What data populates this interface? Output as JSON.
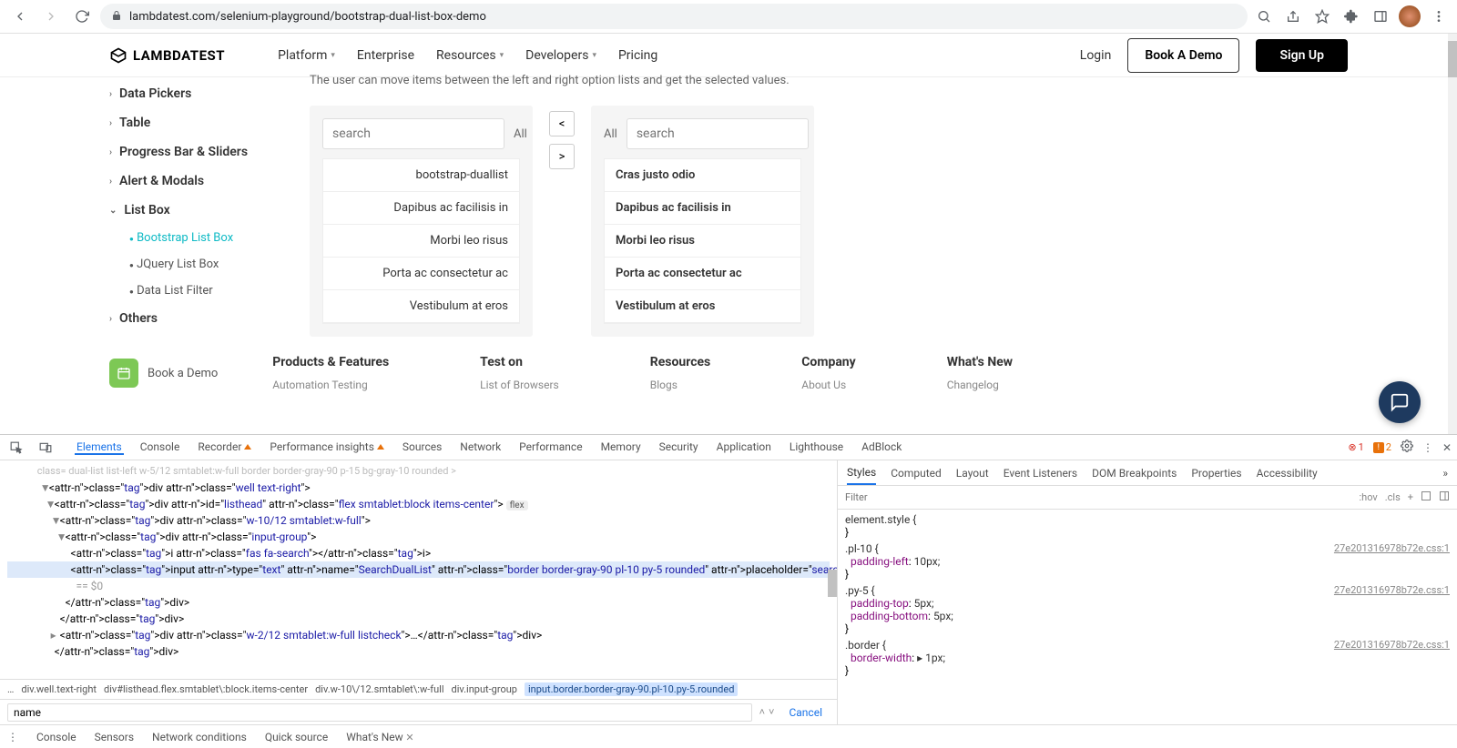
{
  "browser": {
    "url_display": "lambdatest.com/selenium-playground/bootstrap-dual-list-box-demo"
  },
  "topnav": {
    "brand": "LAMBDATEST",
    "links": [
      "Platform",
      "Enterprise",
      "Resources",
      "Developers",
      "Pricing"
    ],
    "login": "Login",
    "book_demo": "Book A Demo",
    "signup": "Sign Up"
  },
  "sidebar": {
    "items": [
      {
        "label": "Data Pickers",
        "expanded": false
      },
      {
        "label": "Table",
        "expanded": false
      },
      {
        "label": "Progress Bar & Sliders",
        "expanded": false
      },
      {
        "label": "Alert & Modals",
        "expanded": false
      },
      {
        "label": "List Box",
        "expanded": true,
        "sub": [
          {
            "label": "Bootstrap List Box",
            "active": true
          },
          {
            "label": "JQuery List Box",
            "active": false
          },
          {
            "label": "Data List Filter",
            "active": false
          }
        ]
      },
      {
        "label": "Others",
        "expanded": false
      }
    ]
  },
  "playground": {
    "description": "The user can move items between the left and right option lists and get the selected values.",
    "search_placeholder": "search",
    "all_label": "All",
    "move_left": "<",
    "move_right": ">",
    "left_list": [
      "bootstrap-duallist",
      "Dapibus ac facilisis in",
      "Morbi leo risus",
      "Porta ac consectetur ac",
      "Vestibulum at eros"
    ],
    "right_list": [
      "Cras justo odio",
      "Dapibus ac facilisis in",
      "Morbi leo risus",
      "Porta ac consectetur ac",
      "Vestibulum at eros"
    ]
  },
  "footer": {
    "book_demo": "Book a Demo",
    "cols": [
      {
        "head": "Products & Features",
        "links": [
          "Automation Testing"
        ]
      },
      {
        "head": "Test on",
        "links": [
          "List of Browsers"
        ]
      },
      {
        "head": "Resources",
        "links": [
          "Blogs"
        ]
      },
      {
        "head": "Company",
        "links": [
          "About Us"
        ]
      },
      {
        "head": "What's New",
        "links": [
          "Changelog"
        ]
      }
    ]
  },
  "devtools": {
    "tabs": [
      "Elements",
      "Console",
      "Recorder",
      "Performance insights",
      "Sources",
      "Network",
      "Performance",
      "Memory",
      "Security",
      "Application",
      "Lighthouse",
      "AdBlock"
    ],
    "badge_errors": "1",
    "badge_warnings": "2",
    "html_lines": [
      {
        "indent": 6,
        "caret": "▼",
        "html": "<div class=\"well text-right\">"
      },
      {
        "indent": 7,
        "caret": "▼",
        "html": "<div id=\"listhead\" class=\"flex smtablet:block items-center\">",
        "badge": "flex"
      },
      {
        "indent": 8,
        "caret": "▼",
        "html": "<div class=\"w-10/12 smtablet:w-full\">"
      },
      {
        "indent": 9,
        "caret": "▼",
        "html": "<div class=\"input-group\">"
      },
      {
        "indent": 10,
        "caret": " ",
        "html": "<i class=\"fas fa-search\"></i>"
      },
      {
        "indent": 10,
        "caret": " ",
        "highlighted": true,
        "input_line": true,
        "html": "<input type=\"text\" name=\"SearchDualList\" class=\"border border-gray-90 pl-10 py-5 rounded\" placeholder=\"search\">"
      },
      {
        "indent": 11,
        "caret": " ",
        "comment": true,
        "html": "== $0"
      },
      {
        "indent": 9,
        "caret": " ",
        "html": "</div>"
      },
      {
        "indent": 8,
        "caret": " ",
        "html": "</div>"
      },
      {
        "indent": 8,
        "caret": "▸",
        "html": "<div class=\"w-2/12 smtablet:w-full listcheck\">…</div>"
      },
      {
        "indent": 7,
        "caret": " ",
        "html": "</div>"
      }
    ],
    "cutoff_top": "class= dual-list list-left w-5/12 smtablet:w-full border border-gray-90 p-15 bg-gray-10 rounded >",
    "breadcrumb": [
      "…",
      "div.well.text-right",
      "div#listhead.flex.smtablet\\:block.items-center",
      "div.w-10\\/12.smtablet\\:w-full",
      "div.input-group",
      "input.border.border-gray-90.pl-10.py-5.rounded"
    ],
    "search_value": "name",
    "search_cancel": "Cancel",
    "styles": {
      "tabs": [
        "Styles",
        "Computed",
        "Layout",
        "Event Listeners",
        "DOM Breakpoints",
        "Properties",
        "Accessibility"
      ],
      "filter_placeholder": "Filter",
      "hov": ":hov",
      "cls": ".cls",
      "rules": [
        {
          "selector": "element.style {",
          "props": [],
          "close": "}"
        },
        {
          "selector": ".pl-10 {",
          "source": "27e201316978b72e.css:1",
          "props": [
            {
              "n": "padding-left",
              "v": "10px;"
            }
          ],
          "close": "}"
        },
        {
          "selector": ".py-5 {",
          "source": "27e201316978b72e.css:1",
          "props": [
            {
              "n": "padding-top",
              "v": "5px;"
            },
            {
              "n": "padding-bottom",
              "v": "5px;"
            }
          ],
          "close": "}"
        },
        {
          "selector": ".border {",
          "source": "27e201316978b72e.css:1",
          "props": [
            {
              "n": "border-width",
              "v": "▸ 1px;"
            }
          ],
          "close": "}"
        }
      ]
    },
    "drawer_tabs": [
      "Console",
      "Sensors",
      "Network conditions",
      "Quick source",
      "What's New"
    ]
  }
}
